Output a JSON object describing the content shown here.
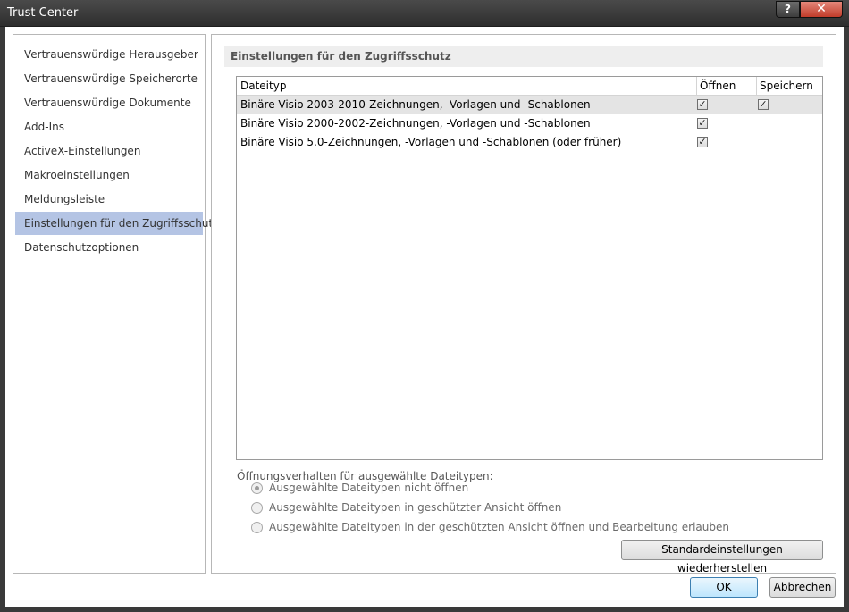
{
  "window": {
    "title": "Trust Center",
    "help_label": "?",
    "close_label": "✕"
  },
  "nav": {
    "items": [
      {
        "label": "Vertrauenswürdige Herausgeber"
      },
      {
        "label": "Vertrauenswürdige Speicherorte"
      },
      {
        "label": "Vertrauenswürdige Dokumente"
      },
      {
        "label": "Add-Ins"
      },
      {
        "label": "ActiveX-Einstellungen"
      },
      {
        "label": "Makroeinstellungen"
      },
      {
        "label": "Meldungsleiste"
      },
      {
        "label": "Einstellungen für den Zugriffsschutz"
      },
      {
        "label": "Datenschutzoptionen"
      }
    ],
    "selected_index": 7
  },
  "main": {
    "section_title": "Einstellungen für den Zugriffsschutz",
    "table": {
      "columns": [
        "Dateityp",
        "Öffnen",
        "Speichern"
      ],
      "rows": [
        {
          "file_type": "Binäre Visio 2003-2010-Zeichnungen, -Vorlagen und -Schablonen",
          "open": true,
          "save": true
        },
        {
          "file_type": "Binäre Visio 2000-2002-Zeichnungen, -Vorlagen und -Schablonen",
          "open": true,
          "save": null
        },
        {
          "file_type": "Binäre Visio 5.0-Zeichnungen, -Vorlagen und -Schablonen (oder früher)",
          "open": true,
          "save": null
        }
      ],
      "selected_row": 0
    },
    "open_behavior": {
      "label": "Öffnungsverhalten für ausgewählte Dateitypen:",
      "options": [
        "Ausgewählte Dateitypen nicht öffnen",
        "Ausgewählte Dateitypen in geschützter Ansicht öffnen",
        "Ausgewählte Dateitypen in der geschützten Ansicht öffnen und Bearbeitung erlauben"
      ],
      "selected_index": 0
    },
    "restore_defaults_label": "Standardeinstellungen wiederherstellen"
  },
  "footer": {
    "ok_label": "OK",
    "cancel_label": "Abbrechen"
  }
}
